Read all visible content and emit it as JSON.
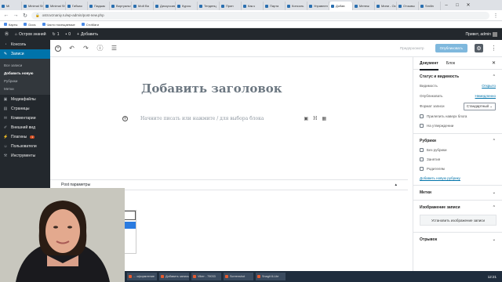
{
  "browser": {
    "tabs": [
      {
        "label": "Mi"
      },
      {
        "label": "Minimal Sh"
      },
      {
        "label": "Minimal Sh"
      },
      {
        "label": "Гибкая"
      },
      {
        "label": "Пиджак"
      },
      {
        "label": "Виртуальн"
      },
      {
        "label": "Мой Ва"
      },
      {
        "label": "Дискуссия"
      },
      {
        "label": "Курсы"
      },
      {
        "label": "Тенденц"
      },
      {
        "label": "Прин"
      },
      {
        "label": "Как к"
      },
      {
        "label": "Парта"
      },
      {
        "label": "Консоль"
      },
      {
        "label": "Управлен"
      },
      {
        "label": "Добав",
        "active": true
      },
      {
        "label": "Менеж"
      },
      {
        "label": "Мини - Ос"
      },
      {
        "label": "Отзывы"
      },
      {
        "label": "Smilin"
      }
    ],
    "url": "ostrovznaniy.ru/wp-admin/post-new.php",
    "bookmarks": [
      "Карты",
      "Docs",
      "Часто посещаемые",
      "СтоМаги"
    ]
  },
  "adminbar": {
    "site": "Остров знаний",
    "comments_count": "1",
    "updates_count": "0",
    "add_label": "Добавить",
    "greeting": "Привет, admin"
  },
  "sidebar": {
    "items": [
      {
        "label": "Консоль",
        "icon": "dashboard-icon"
      },
      {
        "label": "Записи",
        "icon": "pin-icon",
        "active": true
      },
      {
        "label": "Медиафайлы",
        "icon": "media-icon"
      },
      {
        "label": "Страницы",
        "icon": "pages-icon"
      },
      {
        "label": "Комментарии",
        "icon": "comment-icon"
      },
      {
        "label": "Внешний вид",
        "icon": "brush-icon"
      },
      {
        "label": "Плагины",
        "icon": "plugin-icon",
        "badge": "1"
      },
      {
        "label": "Пользователи",
        "icon": "users-icon"
      },
      {
        "label": "Инструменты",
        "icon": "tools-icon"
      }
    ],
    "submenu": [
      "Все записи",
      "Добавить новую",
      "Рубрики",
      "Метки"
    ]
  },
  "editor": {
    "draft_label": "Предпросмотр",
    "publish_label": "Опубликовать",
    "title_placeholder": "Добавить заголовок",
    "block_placeholder": "Начните писать или нажмите / для выбора блока",
    "metabox_label": "Post параметры"
  },
  "panel": {
    "tab_document": "Документ",
    "tab_block": "Блок",
    "status_header": "Статус и видимость",
    "visibility_label": "Видимость",
    "visibility_value": "Открыто",
    "publish_label": "Опубликовать",
    "publish_value": "Немедленно",
    "format_label": "Формат записи",
    "format_value": "Стандартный",
    "stick_label": "Прилепить наверх блога",
    "pending_label": "На утверждении",
    "categories_header": "Рубрики",
    "categories": [
      "Без рубрики",
      "Занятия",
      "Родителям"
    ],
    "add_category": "Добавить новую рубрику",
    "tags_header": "Метки",
    "image_header": "Изображение записи",
    "set_image": "Установить изображение записи",
    "excerpt_header": "Отрывок"
  },
  "taskbar": {
    "items": [
      "... оформление",
      "Добавить запись",
      "Viber - 79033",
      "Screenshot",
      "Snagit 8-Lite"
    ],
    "clock": "12:21"
  }
}
